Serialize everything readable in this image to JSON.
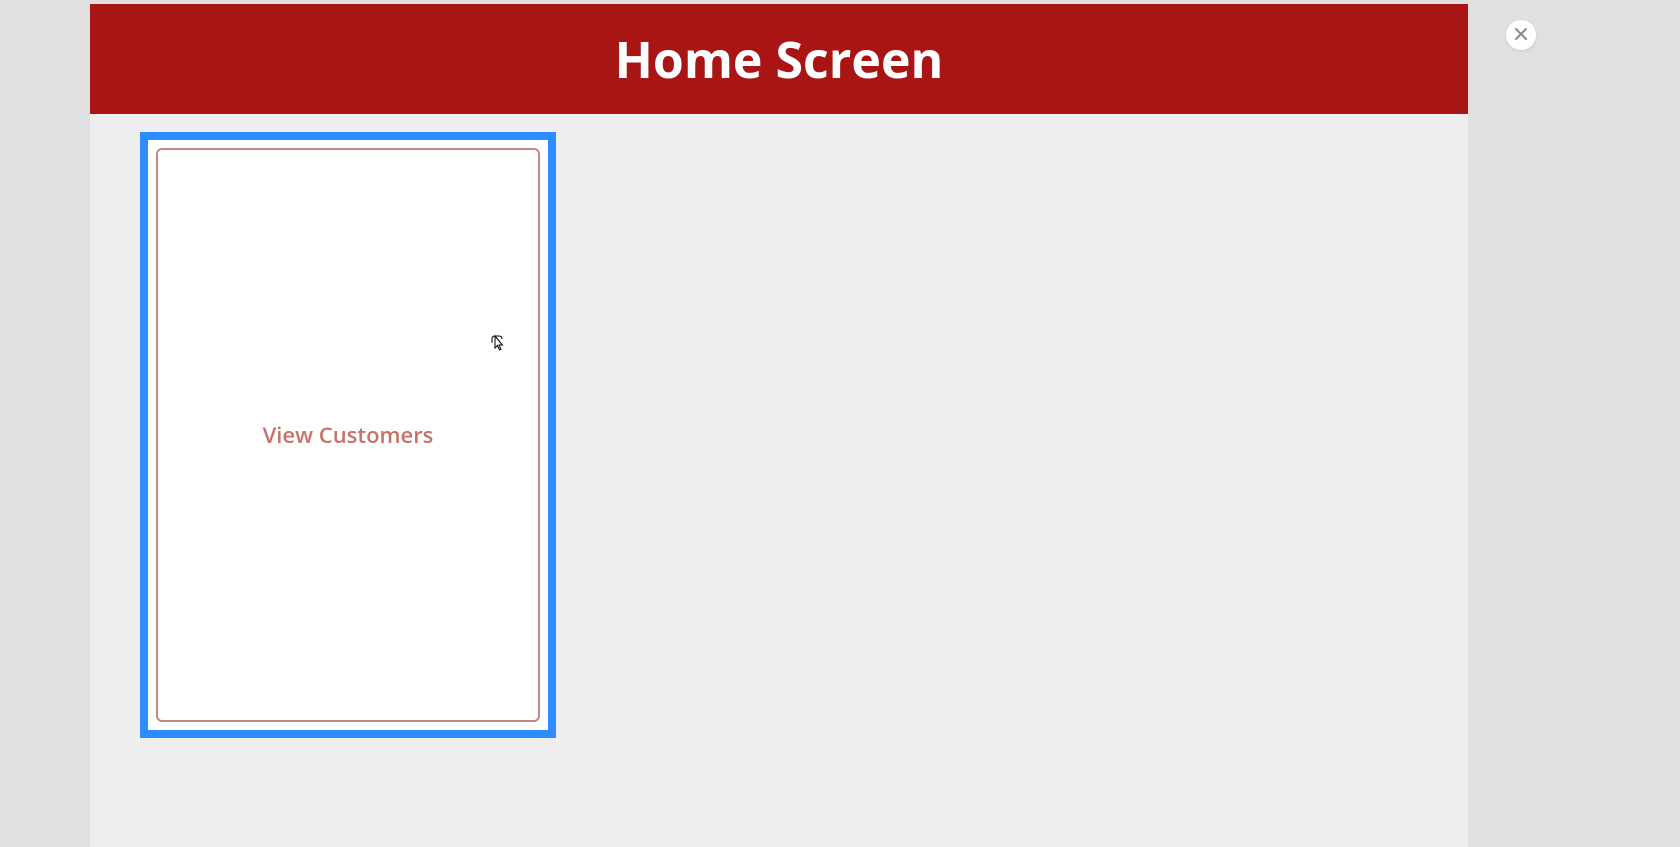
{
  "header": {
    "title": "Home Screen"
  },
  "cards": [
    {
      "label": "View Customers"
    }
  ],
  "colors": {
    "header_bg": "#a91414",
    "card_border": "#2d8cff",
    "card_text": "#c77269"
  }
}
